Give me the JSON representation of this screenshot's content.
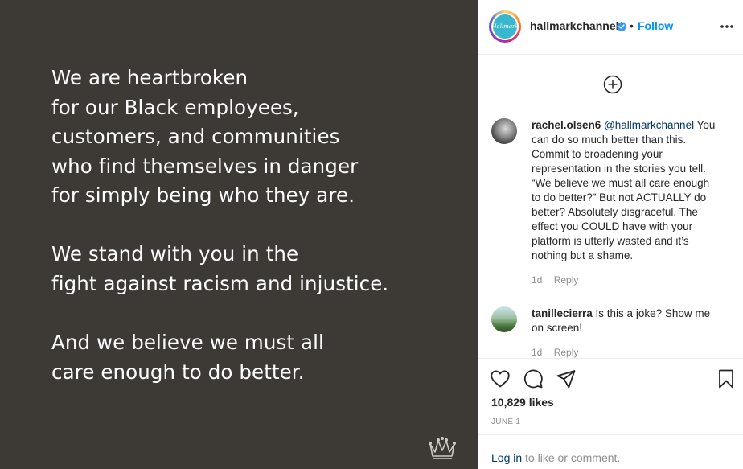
{
  "post_image": {
    "paragraph_1": [
      "We are heartbroken",
      "for our Black employees,",
      "customers, and communities",
      "who find themselves in danger",
      "for simply being who they are."
    ],
    "paragraph_2": [
      "We stand with you in the",
      "fight against racism and injustice."
    ],
    "paragraph_3": [
      "And we believe we must all",
      "care enough to do better."
    ],
    "background_color": "#3d3a36"
  },
  "header": {
    "username": "hallmarkchannel",
    "separator": "•",
    "follow_label": "Follow",
    "avatar_logo_text": "Hallmark"
  },
  "comments": [
    {
      "username": "rachel.olsen6",
      "mention": "@hallmarkchannel",
      "text": " You can do so much better than this. Commit to broadening your representation in the stories you tell. “We believe we must all care enough to do better?” But not ACTUALLY do better? Absolutely disgraceful. The effect you COULD have with your platform is utterly wasted and it’s nothing but a shame.",
      "age": "1d",
      "reply_label": "Reply"
    },
    {
      "username": "tanillecierra",
      "mention": "",
      "text": " Is this a joke? Show me on screen!",
      "age": "1d",
      "reply_label": "Reply"
    }
  ],
  "engagement": {
    "likes": "10,829 likes",
    "date": "JUNE 1"
  },
  "login": {
    "link_label": "Log in",
    "suffix": " to like or comment."
  },
  "colors": {
    "accent_blue": "#0095f6",
    "verified_blue": "#3897f0",
    "muted_text": "#8e8e8e",
    "mention_blue": "#00376b"
  }
}
